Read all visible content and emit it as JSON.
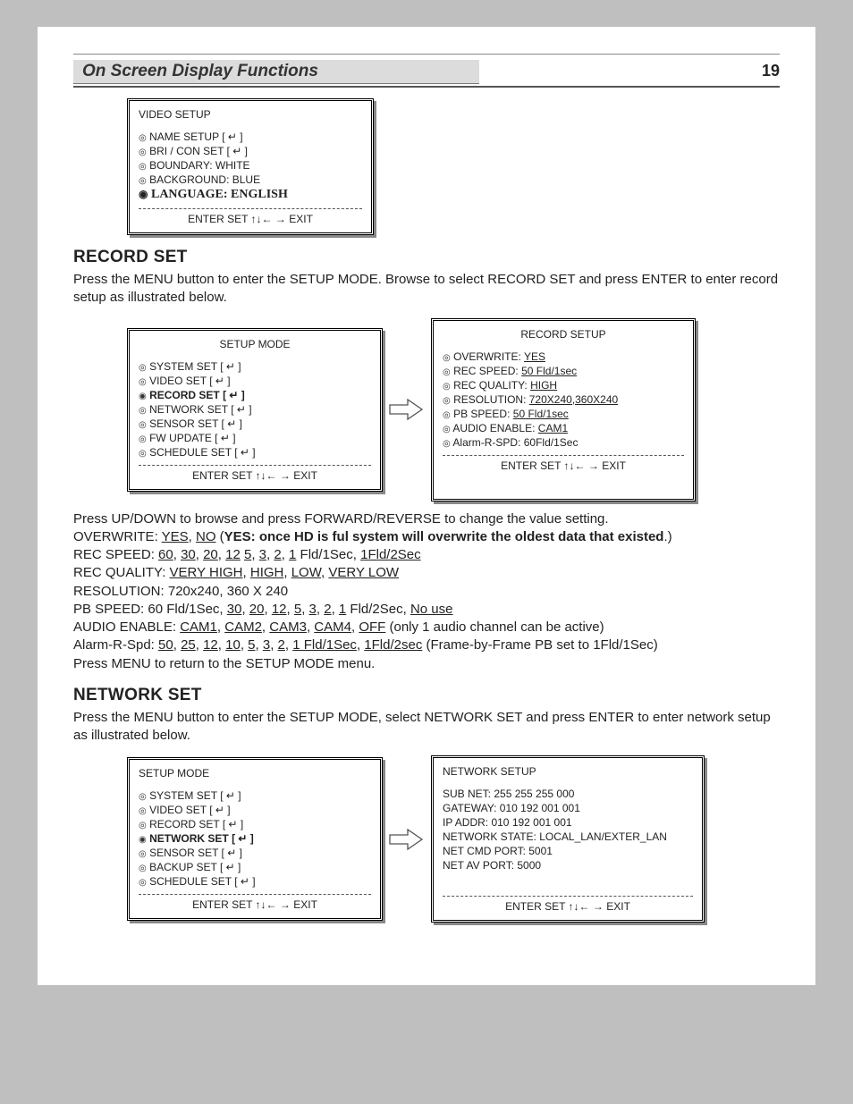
{
  "header": {
    "title": "On Screen Display Functions",
    "page_number": "19"
  },
  "video_setup": {
    "title": "VIDEO SETUP",
    "items": {
      "name_setup": "NAME SETUP [ ↵ ]",
      "bri_con": "BRI / CON SET [ ↵ ]",
      "boundary": "BOUNDARY: WHITE",
      "background": "BACKGROUND: BLUE",
      "language": "LANGUAGE: ENGLISH"
    },
    "footer": "ENTER SET ↑↓← → EXIT"
  },
  "record_set": {
    "heading": "RECORD SET",
    "intro": "Press the MENU button to enter the SETUP MODE. Browse to select RECORD SET and press ENTER to enter record setup as illustrated below.",
    "setup_mode": {
      "title": "SETUP MODE",
      "items": {
        "system": "SYSTEM SET [ ↵ ]",
        "video": "VIDEO SET [ ↵ ]",
        "record": "RECORD SET [ ↵ ]",
        "network": "NETWORK SET [ ↵ ]",
        "sensor": "SENSOR SET [ ↵ ]",
        "fw": "FW UPDATE [ ↵ ]",
        "schedule": "SCHEDULE SET [ ↵ ]"
      },
      "footer": "ENTER SET ↑↓← → EXIT"
    },
    "record_setup": {
      "title": "RECORD SETUP",
      "items": {
        "overwrite": "OVERWRITE: YES",
        "rec_speed": "REC SPEED: 50 Fld/1sec",
        "rec_quality": "REC QUALITY: HIGH",
        "resolution": "RESOLUTION: 720X240,360X240",
        "pb_speed": "PB SPEED: 50 Fld/1sec",
        "audio": "AUDIO ENABLE: CAM1",
        "alarm": "Alarm-R-SPD: 60Fld/1Sec"
      },
      "footer": "ENTER SET ↑↓← → EXIT"
    },
    "body": {
      "l1": "Press UP/DOWN to browse and press FORWARD/REVERSE to change the value setting.",
      "l2a": "OVERWRITE: ",
      "l2b": "YES",
      "l2c": ", ",
      "l2d": "NO",
      "l2e": " (",
      "l2f": "YES: once HD is ful system will overwrite the oldest data that existed",
      "l2g": ".)",
      "l3a": "REC SPEED: ",
      "l3v1": "60",
      "l3v2": "30",
      "l3v3": "20",
      "l3v4": "12",
      "l3v5": "5",
      "l3v6": "3",
      "l3v7": "2",
      "l3v8": "1",
      "l3m": "  Fld/1Sec",
      "l3c": ", ",
      "l3x": "1Fld/2Sec",
      "l4a": "REC QUALITY: ",
      "l4v1": "VERY HIGH",
      "l4v2": "HIGH",
      "l4v3": "LOW,",
      "l4v4": "VERY LOW",
      "l5": "RESOLUTION: 720x240, 360 X 240",
      "l6a": "PB SPEED: 60 Fld/1Sec, ",
      "l6v1": "30",
      "l6v2": "20",
      "l6v3": "12",
      "l6v4": "5",
      "l6v5": "3",
      "l6v6": "2",
      "l6v7": "1",
      "l6m": " Fld/2Sec",
      "l6c": ", ",
      "l6x": "No use",
      "l7a": "AUDIO ENABLE: ",
      "l7v1": "CAM1",
      "l7v2": "CAM2",
      "l7v3": "CAM3",
      "l7v4": "CAM4",
      "l7v5": "OFF",
      "l7t": " (only 1 audio channel can be active)",
      "l8a": "Alarm-R-Spd: ",
      "l8v1": "50",
      "l8v2": "25",
      "l8v3": "12",
      "l8v4": "10",
      "l8v5": "5",
      "l8v6": "3",
      "l8v7": "2",
      "l8v8": "1 Fld/1Sec",
      "l8v9": "1Fld/2sec",
      "l8t": " (Frame-by-Frame PB set to 1Fld/1Sec)",
      "l9": "Press MENU to return to the SETUP MODE menu."
    }
  },
  "network_set": {
    "heading": "NETWORK SET",
    "intro": "Press the MENU button to enter the SETUP MODE, select NETWORK SET and press ENTER to enter network setup as illustrated below.",
    "setup_mode": {
      "title": "SETUP MODE",
      "items": {
        "system": "SYSTEM SET [ ↵ ]",
        "video": "VIDEO SET [ ↵ ]",
        "record": "RECORD SET [ ↵ ]",
        "network": "NETWORK SET [ ↵ ]",
        "sensor": "SENSOR SET [ ↵ ]",
        "backup": "BACKUP SET [ ↵ ]",
        "schedule": "SCHEDULE SET [ ↵ ]"
      },
      "footer": "ENTER SET ↑↓← → EXIT"
    },
    "network_setup": {
      "title": "NETWORK SETUP",
      "items": {
        "subnet": "SUB NET: 255 255 255 000",
        "gateway": "GATEWAY: 010 192 001 001",
        "ipaddr": "IP ADDR: 010 192 001 001",
        "state": "NETWORK STATE: LOCAL_LAN/EXTER_LAN",
        "cmdport": "NET CMD PORT: 5001",
        "avport": "NET AV PORT: 5000"
      },
      "footer": "ENTER SET ↑↓← → EXIT"
    }
  }
}
